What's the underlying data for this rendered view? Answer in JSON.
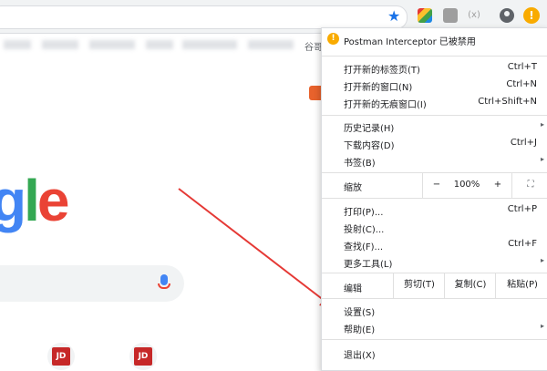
{
  "toolbar": {
    "star_icon": "star-icon",
    "extensions": [
      "colorful-extension-icon",
      "gray-extension-icon",
      "formula-extension-icon"
    ],
    "ext3_glyph": "(x)",
    "avatar_icon": "avatar-icon",
    "warning_icon": "warning-icon",
    "warning_glyph": "!"
  },
  "bookmarks": {
    "trailing_label": "谷哥"
  },
  "google": {
    "logo": {
      "g": "g",
      "l": "l",
      "e": "e"
    },
    "mic_icon": "mic-icon",
    "tiles": [
      "JD",
      "JD"
    ]
  },
  "menu": {
    "header": "Postman Interceptor 已被禁用",
    "items_group1": [
      {
        "label": "打开新的标签页(T)",
        "shortcut": "Ctrl+T"
      },
      {
        "label": "打开新的窗口(N)",
        "shortcut": "Ctrl+N"
      },
      {
        "label": "打开新的无痕窗口(I)",
        "shortcut": "Ctrl+Shift+N"
      }
    ],
    "items_group2": [
      {
        "label": "历史记录(H)",
        "shortcut": "▸"
      },
      {
        "label": "下载内容(D)",
        "shortcut": "Ctrl+J"
      },
      {
        "label": "书签(B)",
        "shortcut": "▸"
      }
    ],
    "zoom": {
      "label": "缩放",
      "minus": "−",
      "value": "100%",
      "plus": "+",
      "fullscreen": "⛶"
    },
    "items_group3": [
      {
        "label": "打印(P)...",
        "shortcut": "Ctrl+P"
      },
      {
        "label": "投射(C)...",
        "shortcut": ""
      },
      {
        "label": "查找(F)...",
        "shortcut": "Ctrl+F"
      },
      {
        "label": "更多工具(L)",
        "shortcut": "▸"
      }
    ],
    "edit": {
      "label": "编辑",
      "cut": "剪切(T)",
      "copy": "复制(C)",
      "paste": "粘贴(P)"
    },
    "items_group4": [
      {
        "label": "设置(S)",
        "shortcut": ""
      },
      {
        "label": "帮助(E)",
        "shortcut": "▸"
      }
    ],
    "exit": {
      "label": "退出(X)"
    }
  },
  "colors": {
    "accent": "#1a73e8",
    "warning": "#f9ab00",
    "arrow": "#e53935"
  }
}
